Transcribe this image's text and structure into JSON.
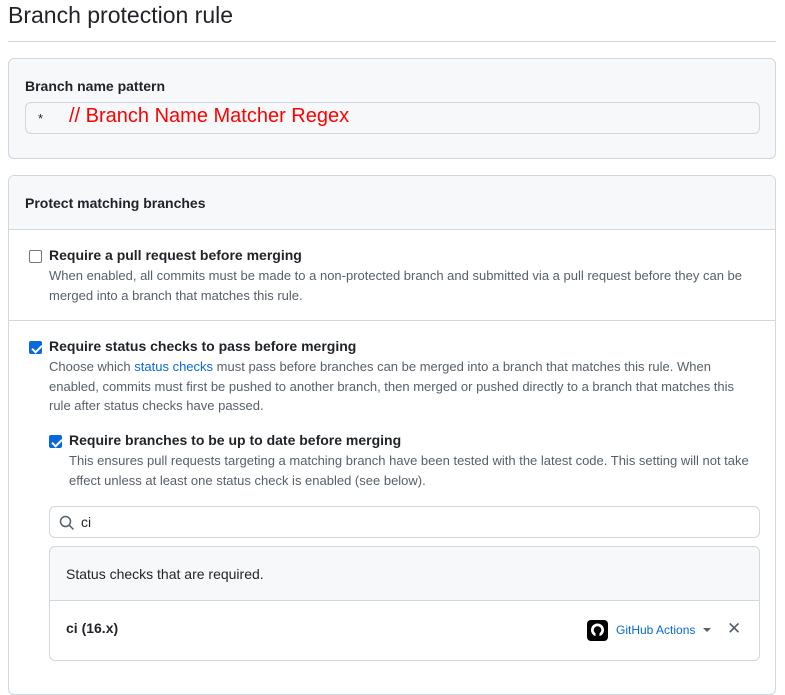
{
  "title": "Branch protection rule",
  "pattern": {
    "label": "Branch name pattern",
    "value": "*",
    "annotation": "// Branch Name Matcher Regex"
  },
  "protect": {
    "heading": "Protect matching branches",
    "pull_request": {
      "label": "Require a pull request before merging",
      "checked": false,
      "description": "When enabled, all commits must be made to a non-protected branch and submitted via a pull request before they can be merged into a branch that matches this rule."
    },
    "status_checks": {
      "label": "Require status checks to pass before merging",
      "checked": true,
      "desc_before": "Choose which ",
      "desc_link": "status checks",
      "desc_after": " must pass before branches can be merged into a branch that matches this rule. When enabled, commits must first be pushed to another branch, then merged or pushed directly to a branch that matches this rule after status checks have passed.",
      "up_to_date": {
        "label": "Require branches to be up to date before merging",
        "checked": true,
        "description": "This ensures pull requests targeting a matching branch have been tested with the latest code. This setting will not take effect unless at least one status check is enabled (see below)."
      },
      "search_value": "ci",
      "required_heading": "Status checks that are required.",
      "checks": [
        {
          "name": "ci (16.x)",
          "app": "GitHub Actions"
        }
      ]
    }
  }
}
